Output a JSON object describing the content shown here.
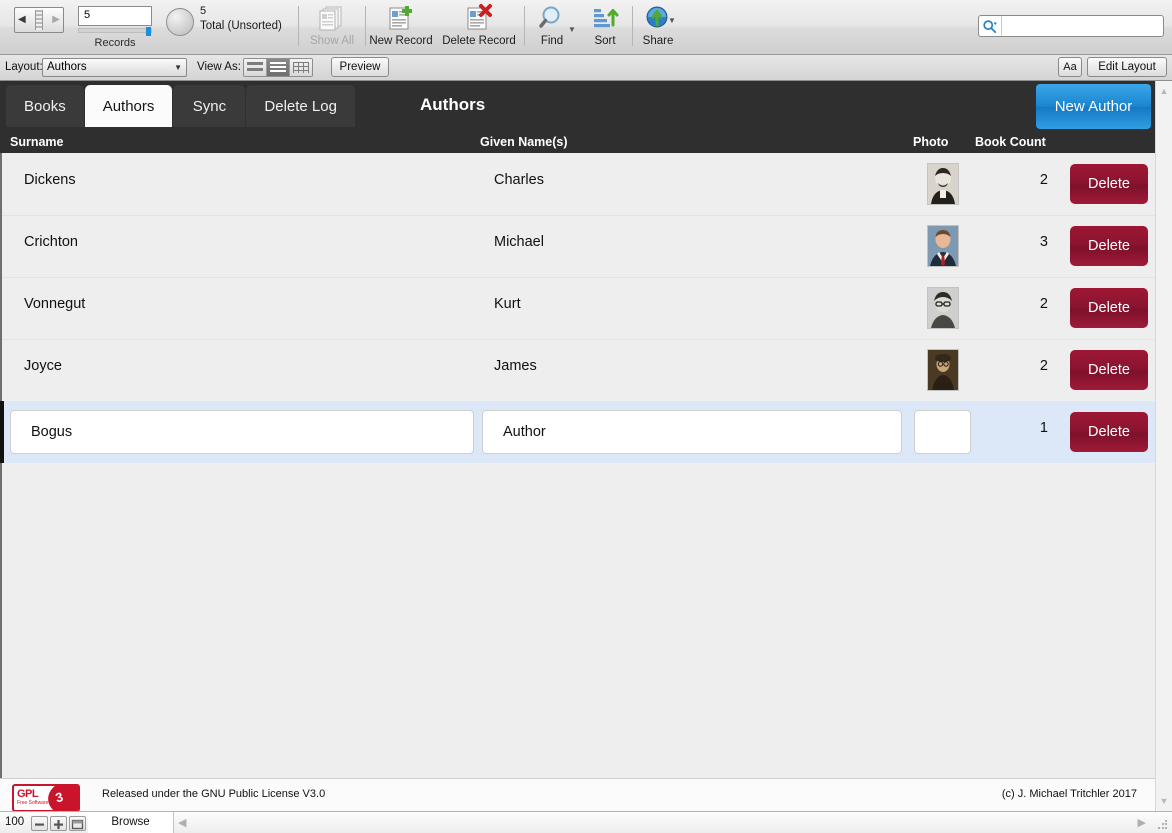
{
  "toolbar": {
    "record_number": "5",
    "records_label": "Records",
    "total_count": "5",
    "total_label": "Total (Unsorted)",
    "buttons": [
      {
        "name": "show-all",
        "label": "Show All",
        "disabled": true
      },
      {
        "name": "new-record",
        "label": "New Record",
        "disabled": false
      },
      {
        "name": "delete-record",
        "label": "Delete Record",
        "disabled": false
      },
      {
        "name": "find",
        "label": "Find",
        "disabled": false
      },
      {
        "name": "sort",
        "label": "Sort",
        "disabled": false
      },
      {
        "name": "share",
        "label": "Share",
        "disabled": false
      }
    ],
    "search_placeholder": ""
  },
  "layoutbar": {
    "layout_label": "Layout:",
    "layout_value": "Authors",
    "view_as_label": "View As:",
    "view_as_options": [
      "form",
      "list",
      "table"
    ],
    "view_as_selected": "list",
    "preview_label": "Preview",
    "text_format_label": "Aa",
    "edit_layout_label": "Edit Layout"
  },
  "header": {
    "tabs": [
      {
        "label": "Books",
        "active": false
      },
      {
        "label": "Authors",
        "active": true
      },
      {
        "label": "Sync",
        "active": false
      },
      {
        "label": "Delete Log",
        "active": false
      }
    ],
    "layout_title": "Authors",
    "new_author_label": "New Author",
    "accent_color": "#1b84d0"
  },
  "table": {
    "columns": [
      {
        "key": "surname",
        "label": "Surname"
      },
      {
        "key": "given",
        "label": "Given Name(s)"
      },
      {
        "key": "photo",
        "label": "Photo"
      },
      {
        "key": "count",
        "label": "Book Count"
      }
    ],
    "delete_label": "Delete",
    "delete_color": "#8c1430",
    "rows": [
      {
        "surname": "Dickens",
        "given": "Charles",
        "count": "2",
        "editing": false,
        "photo_tone": "#3a3730"
      },
      {
        "surname": "Crichton",
        "given": "Michael",
        "count": "3",
        "editing": false,
        "photo_tone": "#9a6a4a"
      },
      {
        "surname": "Vonnegut",
        "given": "Kurt",
        "count": "2",
        "editing": false,
        "photo_tone": "#5e5e5e"
      },
      {
        "surname": "Joyce",
        "given": "James",
        "count": "2",
        "editing": false,
        "photo_tone": "#5d4326"
      },
      {
        "surname": "Bogus",
        "given": "Author",
        "count": "1",
        "editing": true,
        "photo_tone": "#ffffff"
      }
    ]
  },
  "footer": {
    "license_text": "Released under the GNU Public License V3.0",
    "copyright_text": "(c) J. Michael Tritchler 2017",
    "logo_primary": "GPL",
    "logo_secondary": "Free Software",
    "logo_version": "3"
  },
  "statusbar": {
    "zoom_level": "100",
    "mode_label": "Browse"
  }
}
